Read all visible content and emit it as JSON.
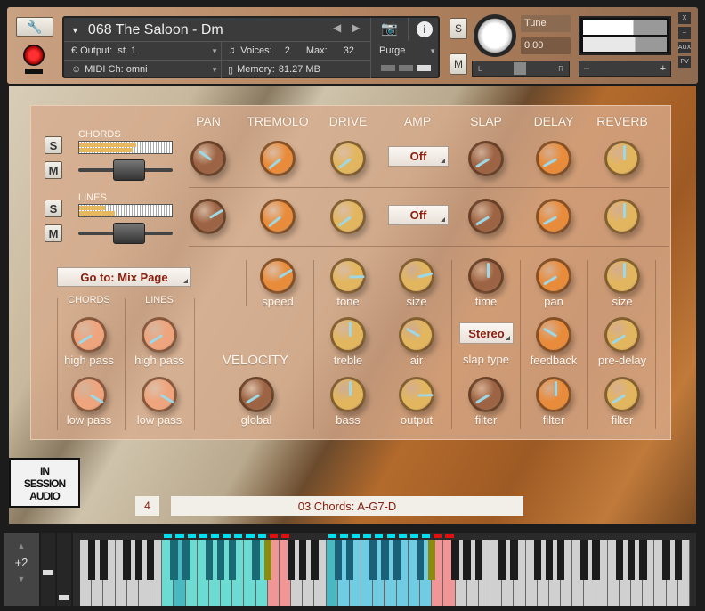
{
  "header": {
    "instrument_name": "068 The Saloon - Dm",
    "output_label": "Output:",
    "output_value": "st. 1",
    "voices_label": "Voices:",
    "voices_value": "2",
    "max_label": "Max:",
    "max_value": "32",
    "midi_label": "MIDI Ch:",
    "midi_value": "omni",
    "memory_label": "Memory:",
    "memory_value": "81.27 MB",
    "purge_label": "Purge",
    "solo_label": "S",
    "mute_label": "M",
    "tune_label": "Tune",
    "tune_value": "0.00",
    "pan_left": "L",
    "pan_right": "R",
    "vol_minus": "–",
    "vol_plus": "+",
    "close_label": "X",
    "min_label": "–",
    "aux_label": "AUX",
    "pv_label": "PV",
    "icons": [
      "wrench-icon",
      "record-icon",
      "camera-icon",
      "info-icon",
      "arrow-left-icon",
      "arrow-right-icon"
    ]
  },
  "mixer": {
    "channels": [
      {
        "name": "CHORDS",
        "solo": "S",
        "mute": "M",
        "meter": [
          0.62,
          0.58
        ],
        "fader": 0.55
      },
      {
        "name": "LINES",
        "solo": "S",
        "mute": "M",
        "meter": [
          0.28,
          0.38
        ],
        "fader": 0.55
      }
    ]
  },
  "sections": [
    "PAN",
    "TREMOLO",
    "DRIVE",
    "AMP",
    "SLAP",
    "DELAY",
    "REVERB"
  ],
  "amp_menus": [
    "Off",
    "Off"
  ],
  "goto_menu": "Go to: Mix Page",
  "filter_groups": [
    "CHORDS",
    "LINES"
  ],
  "velocity_title": "VELOCITY",
  "slap_type_menu": "Stereo",
  "slap_type_label": "slap type",
  "knob_colors": {
    "brown": "#9c6444",
    "orange": "#e88c3c",
    "yellow": "#e2b65e",
    "peach": "#eea47c"
  },
  "knobs": [
    {
      "id": "chords-pan",
      "label": "",
      "value": 0.3,
      "color": "brown"
    },
    {
      "id": "chords-tremolo",
      "label": "",
      "value": 0.02,
      "color": "orange"
    },
    {
      "id": "chords-drive",
      "label": "",
      "value": 0.03,
      "color": "yellow"
    },
    {
      "id": "chords-slap",
      "label": "",
      "value": 0.05,
      "color": "brown"
    },
    {
      "id": "chords-delay",
      "label": "",
      "value": 0.06,
      "color": "orange"
    },
    {
      "id": "chords-reverb",
      "label": "",
      "value": 0.5,
      "color": "yellow"
    },
    {
      "id": "lines-pan",
      "label": "",
      "value": 0.72,
      "color": "brown"
    },
    {
      "id": "lines-tremolo",
      "label": "",
      "value": 0.02,
      "color": "orange"
    },
    {
      "id": "lines-drive",
      "label": "",
      "value": 0.03,
      "color": "yellow"
    },
    {
      "id": "lines-slap",
      "label": "",
      "value": 0.05,
      "color": "brown"
    },
    {
      "id": "lines-delay",
      "label": "",
      "value": 0.06,
      "color": "orange"
    },
    {
      "id": "lines-reverb",
      "label": "",
      "value": 0.5,
      "color": "yellow"
    },
    {
      "id": "tremolo-speed",
      "label": "speed",
      "value": 0.72,
      "color": "orange"
    },
    {
      "id": "drive-tone",
      "label": "tone",
      "value": 0.83,
      "color": "yellow"
    },
    {
      "id": "amp-size",
      "label": "size",
      "value": 0.78,
      "color": "yellow"
    },
    {
      "id": "slap-time",
      "label": "time",
      "value": 0.5,
      "color": "brown"
    },
    {
      "id": "delay-pan",
      "label": "pan",
      "value": 0.05,
      "color": "orange"
    },
    {
      "id": "reverb-size",
      "label": "size",
      "value": 0.5,
      "color": "yellow"
    },
    {
      "id": "drive-treble",
      "label": "treble",
      "value": 0.5,
      "color": "yellow"
    },
    {
      "id": "amp-air",
      "label": "air",
      "value": 0.28,
      "color": "yellow"
    },
    {
      "id": "delay-feedback",
      "label": "feedback",
      "value": 0.28,
      "color": "orange"
    },
    {
      "id": "reverb-pre-delay",
      "label": "pre-delay",
      "value": 0.05,
      "color": "yellow"
    },
    {
      "id": "drive-bass",
      "label": "bass",
      "value": 0.5,
      "color": "yellow"
    },
    {
      "id": "amp-output",
      "label": "output",
      "value": 0.83,
      "color": "yellow"
    },
    {
      "id": "slap-filter",
      "label": "filter",
      "value": 0.05,
      "color": "brown"
    },
    {
      "id": "delay-filter",
      "label": "filter",
      "value": 0.5,
      "color": "orange"
    },
    {
      "id": "reverb-filter",
      "label": "filter",
      "value": 0.05,
      "color": "yellow"
    },
    {
      "id": "chords-high-pass",
      "label": "high pass",
      "value": 0.05,
      "color": "peach"
    },
    {
      "id": "lines-high-pass",
      "label": "high pass",
      "value": 0.05,
      "color": "peach"
    },
    {
      "id": "chords-low-pass",
      "label": "low pass",
      "value": 0.95,
      "color": "peach"
    },
    {
      "id": "lines-low-pass",
      "label": "low pass",
      "value": 0.95,
      "color": "peach"
    },
    {
      "id": "velocity-global",
      "label": "global",
      "value": 0.05,
      "color": "brown"
    }
  ],
  "logo": "IN SESSION AUDIO",
  "preset_number": "4",
  "preset_name": "03 Chords: A-G7-D",
  "keyboard": {
    "octave_shift": "+2",
    "white_keys": 52,
    "zones": [
      {
        "from": 7,
        "to": 15,
        "color": "#6cdcd2",
        "black": "#1a6a76"
      },
      {
        "from": 16,
        "to": 17,
        "color": "#f09696",
        "black": "#1c1c1c"
      },
      {
        "from": 21,
        "to": 29,
        "color": "#70cce2",
        "black": "#1a6078"
      },
      {
        "from": 30,
        "to": 31,
        "color": "#f09696",
        "black": "#1c1c1c"
      }
    ],
    "keyswitch_color": "#8c8a10",
    "pressed_keys": [
      8,
      21
    ]
  }
}
